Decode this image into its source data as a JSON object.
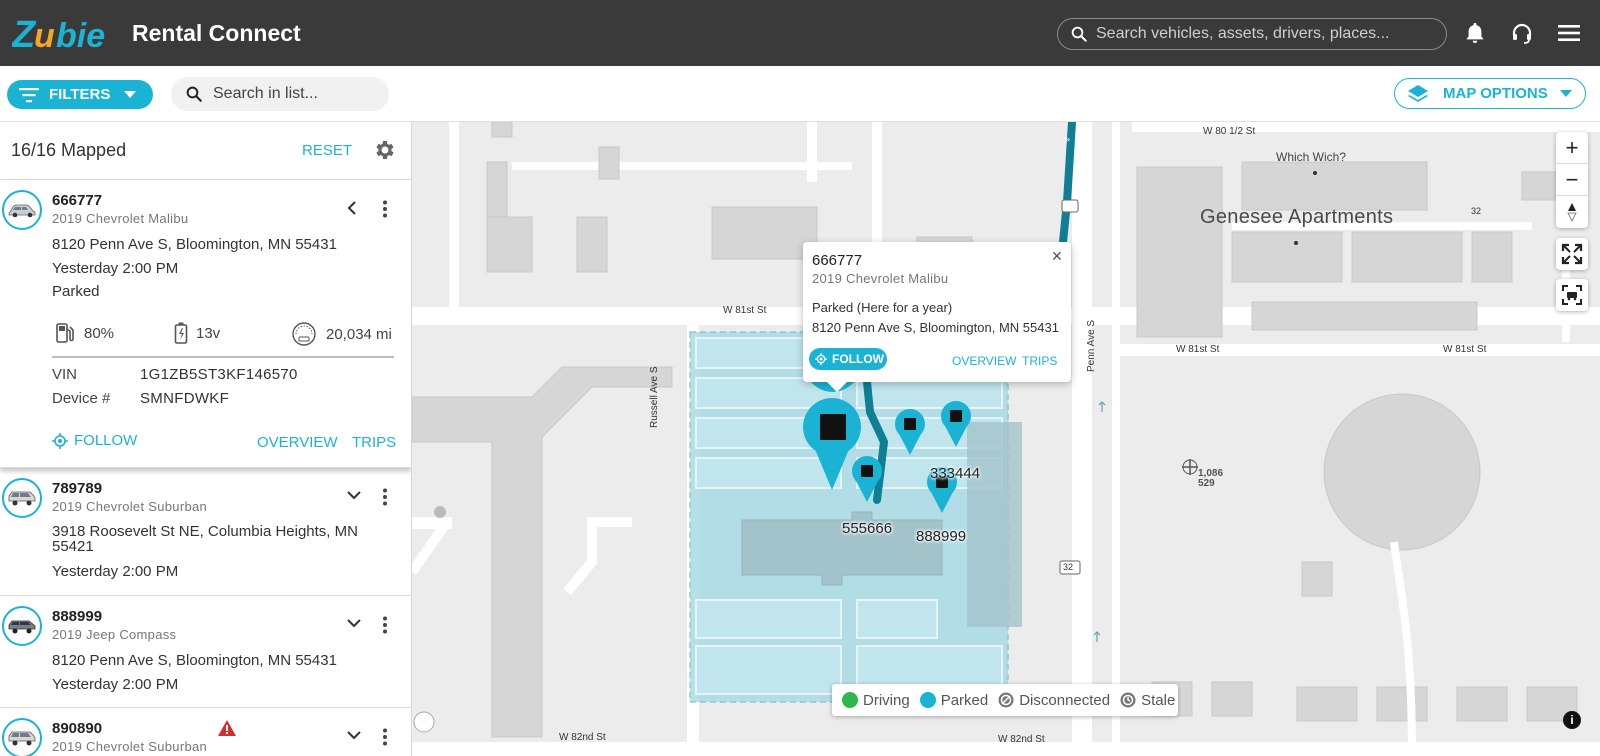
{
  "app": {
    "title": "Rental Connect",
    "logo_text": "Zubie",
    "global_search_placeholder": "Search vehicles, assets, drivers, places..."
  },
  "icons": {
    "notifications": "bell-icon",
    "support": "headset-icon",
    "menu": "hamburger-icon"
  },
  "toolbar": {
    "filters_label": "FILTERS",
    "list_search_placeholder": "Search in list...",
    "map_options_label": "MAP OPTIONS"
  },
  "panel": {
    "mapped_count": "16/16 Mapped",
    "reset_label": "RESET",
    "vehicles": [
      {
        "id": "666777",
        "model": "2019 Chevrolet Malibu",
        "address": "8120 Penn Ave S, Bloomington, MN 55431",
        "time": "Yesterday 2:00 PM",
        "status": "Parked",
        "fuel": "80%",
        "battery": "13v",
        "odometer": "20,034 mi",
        "vin_label": "VIN",
        "vin": "1G1ZB5ST3KF146570",
        "device_label": "Device #",
        "device": "SMNFDWKF",
        "follow_label": "FOLLOW",
        "overview_label": "OVERVIEW",
        "trips_label": "TRIPS"
      },
      {
        "id": "789789",
        "model": "2019 Chevrolet Suburban",
        "address_line1": "3918 Roosevelt St NE, Columbia Heights, MN",
        "address_line2": "55421",
        "time": "Yesterday 2:00 PM"
      },
      {
        "id": "888999",
        "model": "2019 Jeep Compass",
        "address": "8120 Penn Ave S, Bloomington, MN 55431",
        "time": "Yesterday 2:00 PM"
      },
      {
        "id": "890890",
        "model": "2019 Chevrolet Suburban",
        "alert": "warning-icon"
      }
    ]
  },
  "map": {
    "streets": {
      "w80half": "W 80 1/2 St",
      "w81_top": "W 81st St",
      "w81_right1": "W 81st St",
      "w81_right2": "W 81st St",
      "russell": "Russell Ave S",
      "penn": "Penn Ave S",
      "w82": "W 82nd St",
      "w82b": "W 82nd St",
      "route_top": "32",
      "route_bottom": "32"
    },
    "places": {
      "genesee": "Genesee Apartments",
      "which_wich": "Which Wich?",
      "coord_a": "1,086",
      "coord_b": "529"
    },
    "pins": {
      "p555666": "555666",
      "p888999": "888999",
      "p333444": "333444"
    },
    "popup": {
      "id": "666777",
      "model": "2019 Chevrolet Malibu",
      "status": "Parked (Here for a year)",
      "address": "8120 Penn Ave S, Bloomington, MN 55431",
      "follow_label": "FOLLOW",
      "overview_label": "OVERVIEW",
      "trips_label": "TRIPS",
      "close": "✕"
    },
    "legend": {
      "driving": "Driving",
      "parked": "Parked",
      "disconnected": "Disconnected",
      "stale": "Stale"
    },
    "zoom_in": "+",
    "zoom_out": "−",
    "info": "i"
  },
  "colors": {
    "accent": "#1bb3d4",
    "header": "#3a3a3a",
    "driving": "#2db84d",
    "parked": "#1bb3d4",
    "route": "#0e7f94",
    "alert": "#d32f2f"
  }
}
